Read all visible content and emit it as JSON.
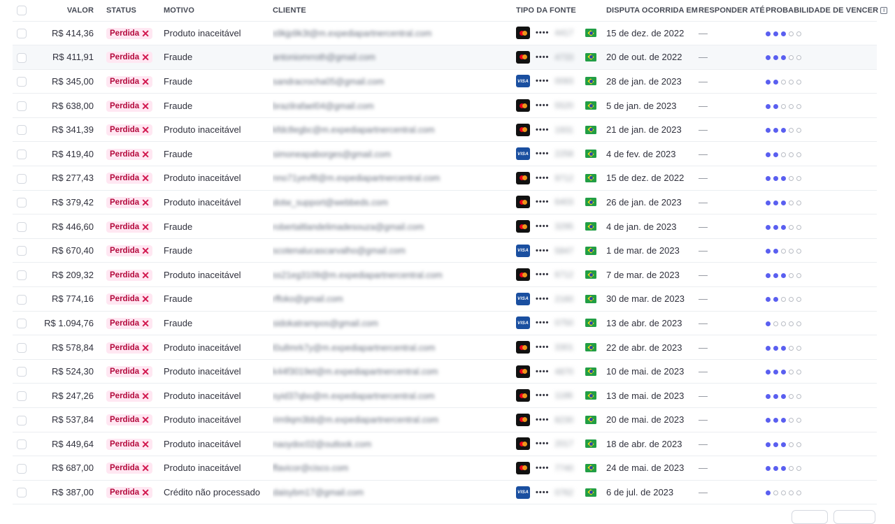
{
  "headers": {
    "amount": "VALOR",
    "status": "STATUS",
    "reason": "MOTIVO",
    "customer": "CLIENTE",
    "source_type": "TIPO DA FONTE",
    "dispute_date": "DISPUTA OCORRIDA EM",
    "respond_by": "RESPONDER ATÉ",
    "win_probability": "PROBABILIDADE DE VENCER"
  },
  "status_label": "Perdida",
  "rows": [
    {
      "amount": "R$ 414,36",
      "reason": "Produto inaceitável",
      "customer": "s9kjp9k3t@m.expediapartnercentral.com",
      "brand": "mastercard",
      "last4": "4417",
      "date": "15 de dez. de 2022",
      "respond": "—",
      "prob": 3
    },
    {
      "amount": "R$ 411,91",
      "reason": "Fraude",
      "customer": "antoniomrroth@gmail.com",
      "brand": "mastercard",
      "last4": "4733",
      "date": "20 de out. de 2022",
      "respond": "—",
      "prob": 3
    },
    {
      "amount": "R$ 345,00",
      "reason": "Fraude",
      "customer": "sandracrocha05@gmail.com",
      "brand": "visa",
      "last4": "0093",
      "date": "28 de jan. de 2023",
      "respond": "—",
      "prob": 2
    },
    {
      "amount": "R$ 638,00",
      "reason": "Fraude",
      "customer": "brazilrafael04@gmail.com",
      "brand": "mastercard",
      "last4": "5520",
      "date": "5 de jan. de 2023",
      "respond": "—",
      "prob": 2
    },
    {
      "amount": "R$ 341,39",
      "reason": "Produto inaceitável",
      "customer": "kfdc8egbc@m.expediapartnercentral.com",
      "brand": "mastercard",
      "last4": "1931",
      "date": "21 de jan. de 2023",
      "respond": "—",
      "prob": 3
    },
    {
      "amount": "R$ 419,40",
      "reason": "Fraude",
      "customer": "simoneapaborges@gmail.com",
      "brand": "visa",
      "last4": "2258",
      "date": "4 de fev. de 2023",
      "respond": "—",
      "prob": 2
    },
    {
      "amount": "R$ 277,43",
      "reason": "Produto inaceitável",
      "customer": "nno71yevf8@m.expediapartnercentral.com",
      "brand": "mastercard",
      "last4": "9712",
      "date": "15 de dez. de 2022",
      "respond": "—",
      "prob": 3
    },
    {
      "amount": "R$ 379,42",
      "reason": "Produto inaceitável",
      "customer": "dotw_support@webbeds.com",
      "brand": "mastercard",
      "last4": "6403",
      "date": "26 de jan. de 2023",
      "respond": "—",
      "prob": 3
    },
    {
      "amount": "R$ 446,60",
      "reason": "Fraude",
      "customer": "robertaltlandelimadesouza@gmail.com",
      "brand": "mastercard",
      "last4": "3295",
      "date": "4 de jan. de 2023",
      "respond": "—",
      "prob": 3
    },
    {
      "amount": "R$ 670,40",
      "reason": "Fraude",
      "customer": "scotenalucascarvalho@gmail.com",
      "brand": "visa",
      "last4": "5847",
      "date": "1 de mar. de 2023",
      "respond": "—",
      "prob": 2
    },
    {
      "amount": "R$ 209,32",
      "reason": "Produto inaceitável",
      "customer": "ss21eg3109@m.expediapartnercentral.com",
      "brand": "mastercard",
      "last4": "6712",
      "date": "7 de mar. de 2023",
      "respond": "—",
      "prob": 3
    },
    {
      "amount": "R$ 774,16",
      "reason": "Fraude",
      "customer": "rffoko@gmail.com",
      "brand": "visa",
      "last4": "2160",
      "date": "30 de mar. de 2023",
      "respond": "—",
      "prob": 2
    },
    {
      "amount": "R$ 1.094,76",
      "reason": "Fraude",
      "customer": "sidokatrampos@gmail.com",
      "brand": "visa",
      "last4": "0750",
      "date": "13 de abr. de 2023",
      "respond": "—",
      "prob": 1
    },
    {
      "amount": "R$ 578,84",
      "reason": "Produto inaceitável",
      "customer": "l0u8mrk7y@m.expediapartnercentral.com",
      "brand": "mastercard",
      "last4": "3301",
      "date": "22 de abr. de 2023",
      "respond": "—",
      "prob": 3
    },
    {
      "amount": "R$ 524,30",
      "reason": "Produto inaceitável",
      "customer": "k44f3019et@m.expediapartnercentral.com",
      "brand": "mastercard",
      "last4": "4870",
      "date": "10 de mai. de 2023",
      "respond": "—",
      "prob": 3
    },
    {
      "amount": "R$ 247,26",
      "reason": "Produto inaceitável",
      "customer": "syid37qbo@m.expediapartnercentral.com",
      "brand": "mastercard",
      "last4": "1186",
      "date": "13 de mai. de 2023",
      "respond": "—",
      "prob": 3
    },
    {
      "amount": "R$ 537,84",
      "reason": "Produto inaceitável",
      "customer": "rim9qm3bb@m.expediapartnercentral.com",
      "brand": "mastercard",
      "last4": "8230",
      "date": "20 de mai. de 2023",
      "respond": "—",
      "prob": 3
    },
    {
      "amount": "R$ 449,64",
      "reason": "Produto inaceitável",
      "customer": "naoydoc02@outlook.com",
      "brand": "mastercard",
      "last4": "2017",
      "date": "18 de abr. de 2023",
      "respond": "—",
      "prob": 3
    },
    {
      "amount": "R$ 687,00",
      "reason": "Produto inaceitável",
      "customer": "ffavicor@cisco.com",
      "brand": "mastercard",
      "last4": "7740",
      "date": "24 de mai. de 2023",
      "respond": "—",
      "prob": 3
    },
    {
      "amount": "R$ 387,00",
      "reason": "Crédito não processado",
      "customer": "daisybm17@gmail.com",
      "brand": "visa",
      "last4": "0762",
      "date": "6 de jul. de 2023",
      "respond": "—",
      "prob": 1
    }
  ],
  "highlighted_row": 1,
  "probability_max": 5,
  "colors": {
    "badge_bg": "#ffe7f2",
    "badge_text": "#b3093c",
    "prob_on": "#5a5ff0",
    "row_hover": "#f6f8fa"
  },
  "icons": {
    "status": "close-icon",
    "info": "info-icon",
    "flag": "brazil-flag-icon"
  }
}
